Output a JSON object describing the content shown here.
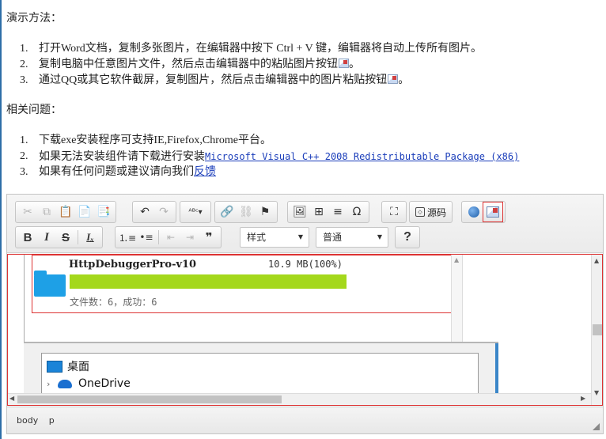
{
  "doc": {
    "demo_heading": "演示方法：",
    "demo_items": [
      {
        "num": "1.",
        "text": "打开Word文档，复制多张图片，在编辑器中按下 Ctrl + V 键，编辑器将自动上传所有图片。"
      },
      {
        "num": "2.",
        "text": "复制电脑中任意图片文件，然后点击编辑器中的粘贴图片按钮",
        "suffix": "。"
      },
      {
        "num": "3.",
        "text": "通过QQ或其它软件截屏，复制图片，然后点击编辑器中的图片粘贴按钮",
        "suffix": "。"
      }
    ],
    "faq_heading": "相关问题：",
    "faq_items": [
      {
        "num": "1.",
        "text": "下载exe安装程序可支持IE,Firefox,Chrome平台。"
      },
      {
        "num": "2.",
        "text": "如果无法安装组件请下载进行安装",
        "link": "Microsoft Visual C++ 2008 Redistributable Package (x86)"
      },
      {
        "num": "3.",
        "text": "如果有任何问题或建议请向我们",
        "link": "反馈"
      }
    ]
  },
  "toolbar": {
    "source_label": "源码",
    "style_combo": "样式",
    "format_combo": "普通",
    "help_label": "?"
  },
  "upload": {
    "file_name": "HttpDebuggerPro-v10",
    "file_size": "10.9 MB(100%)",
    "progress": 1.0,
    "progress_color": "#a4d81c",
    "stats": "文件数：6，成功：6"
  },
  "explorer": {
    "desktop": "桌面",
    "onedrive": "OneDrive"
  },
  "statusbar": {
    "path": [
      "body",
      "p"
    ]
  }
}
